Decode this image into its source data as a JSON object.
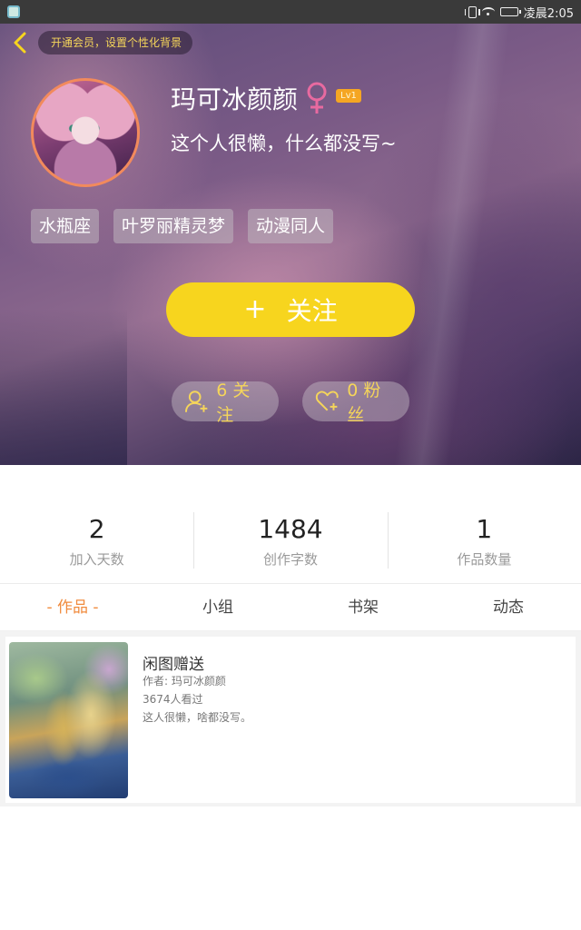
{
  "status_bar": {
    "time": "凌晨2:05"
  },
  "header": {
    "vip_text": "开通会员，设置个性化背景"
  },
  "profile": {
    "username": "玛可冰颜颜",
    "level": "Lv1",
    "bio": "这个人很懒，什么都没写~",
    "tags": [
      "水瓶座",
      "叶罗丽精灵梦",
      "动漫同人"
    ],
    "follow_plus": "+",
    "follow_label": "关注",
    "following": "6 关注",
    "fans": "0 粉丝"
  },
  "stats": [
    {
      "value": "2",
      "label": "加入天数"
    },
    {
      "value": "1484",
      "label": "创作字数"
    },
    {
      "value": "1",
      "label": "作品数量"
    }
  ],
  "tabs": [
    "- 作品 -",
    "小组",
    "书架",
    "动态"
  ],
  "works": [
    {
      "title": "闲图赠送",
      "author": "作者: 玛可冰颜颜",
      "views": "3674人看过",
      "desc": "这人很懒，啥都没写。"
    }
  ],
  "colors": {
    "accent_yellow": "#f7d51e",
    "tab_active": "#f08a3c",
    "avatar_ring": "#f28a5c",
    "level_badge": "#f5a623"
  }
}
